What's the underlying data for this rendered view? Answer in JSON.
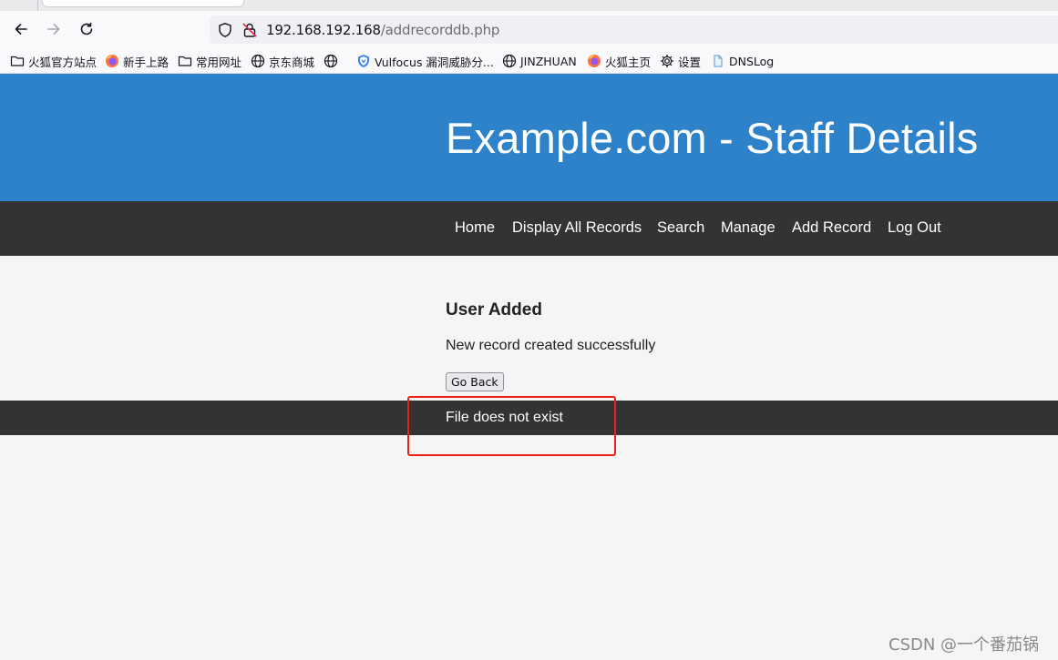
{
  "browser": {
    "url_host": "192.168.192.168",
    "url_path": "/addrecorddb.php",
    "bookmarks": [
      {
        "label": "火狐官方站点",
        "icon": "folder-icon"
      },
      {
        "label": "新手上路",
        "icon": "firefox-icon"
      },
      {
        "label": "常用网址",
        "icon": "folder-icon"
      },
      {
        "label": "京东商城",
        "icon": "globe-icon"
      },
      {
        "label": "",
        "icon": "globe-icon"
      },
      {
        "label": "Vulfocus 漏洞威胁分...",
        "icon": "vulfocus-icon"
      },
      {
        "label": "JINZHUAN",
        "icon": "globe-icon"
      },
      {
        "label": "火狐主页",
        "icon": "firefox-icon"
      },
      {
        "label": "设置",
        "icon": "gear-icon"
      },
      {
        "label": "DNSLog",
        "icon": "dnslog-icon"
      }
    ]
  },
  "site": {
    "title": "Example.com - Staff Details",
    "nav": [
      "Home",
      "Display All Records",
      "Search",
      "Manage",
      "Add Record",
      "Log Out"
    ],
    "content": {
      "heading": "User Added",
      "message": "New record created successfully",
      "button": "Go Back"
    },
    "footer": "File does not exist"
  },
  "colors": {
    "header_bg": "#2e82c9",
    "nav_bg": "#333333",
    "highlight": "#e8211d"
  },
  "watermark": "CSDN @一个番茄锅"
}
